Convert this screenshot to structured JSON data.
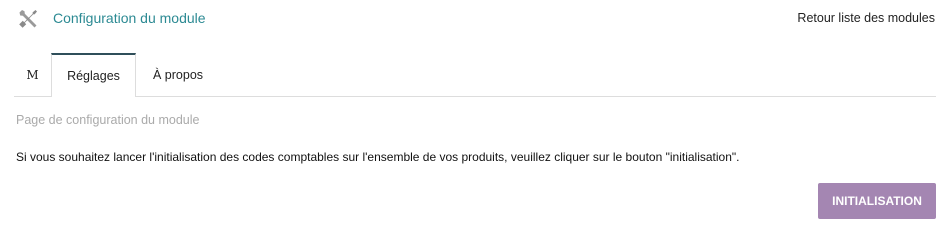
{
  "header": {
    "title": "Configuration du module",
    "back_link": "Retour liste des modules",
    "icon": "tools-icon"
  },
  "tabs": [
    {
      "label": "M",
      "active": false
    },
    {
      "label": "Réglages",
      "active": true
    },
    {
      "label": "À propos",
      "active": false
    }
  ],
  "section": {
    "title": "Page de configuration du module",
    "text": "Si vous souhaitez lancer l'initialisation des codes comptables sur l'ensemble de vos produits, veuillez cliquer sur le bouton \"initialisation\"."
  },
  "button": {
    "label": "INITIALISATION",
    "color": "#a486b2"
  },
  "colors": {
    "title": "#2c8a93",
    "active_tab_border": "#2f4f5a"
  }
}
